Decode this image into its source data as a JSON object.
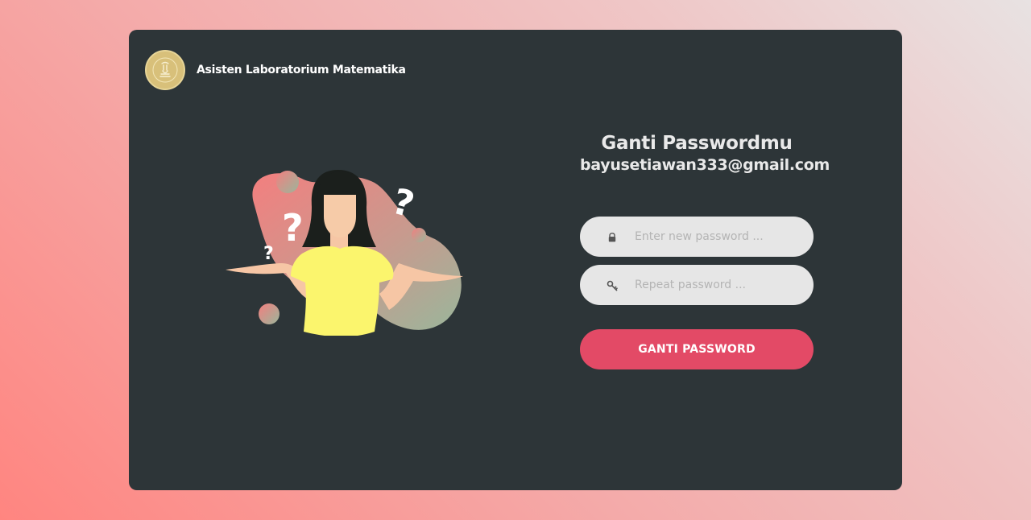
{
  "brand": {
    "name": "Asisten Laboratorium Matematika",
    "logo_icon": "lab-seal-logo-icon",
    "logo_color": "#d8c07a"
  },
  "illustration": {
    "name": "confused-woman-illustration-icon"
  },
  "form": {
    "title": "Ganti Passwordmu",
    "email": "bayusetiawan333@gmail.com",
    "new_password": {
      "icon": "lock-icon",
      "placeholder": "Enter new password ...",
      "value": ""
    },
    "repeat_password": {
      "icon": "key-icon",
      "placeholder": "Repeat password ...",
      "value": ""
    },
    "submit_label": "Ganti Password"
  },
  "colors": {
    "card_background": "#2d3538",
    "button": "#e34a66",
    "input_background": "#e6e6e6",
    "text": "#e9e9e9"
  }
}
